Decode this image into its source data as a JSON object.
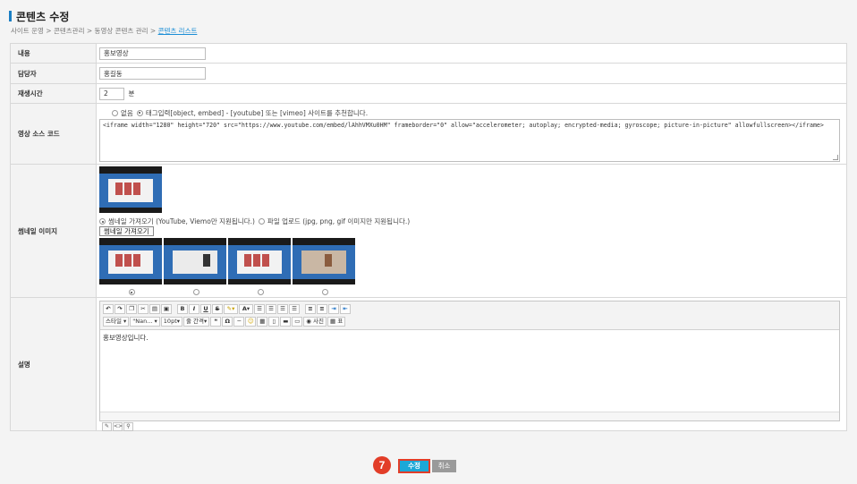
{
  "page": {
    "title": "콘텐츠 수정",
    "breadcrumb": [
      "사이트 운영",
      "콘텐츠관리",
      "동영상 콘텐츠 관리",
      "콘텐츠 리스트"
    ],
    "breadcrumb_sep": ">"
  },
  "form": {
    "content": {
      "label": "내용",
      "value": "홍보영상"
    },
    "manager": {
      "label": "담당자",
      "value": "홍길동"
    },
    "playtime": {
      "label": "재생시간",
      "value": "2",
      "unit": "분"
    },
    "video_source": {
      "label": "영상 소스 코드",
      "option_none": "없음",
      "option_tag": "태그입력[object, embed] - [youtube] 또는 [vimeo] 사이트를 추천합니다.",
      "code": "<iframe width=\"1280\" height=\"720\" src=\"https://www.youtube.com/embed/lAhhVMXu0HM\" frameborder=\"0\" allow=\"accelerometer; autoplay; encrypted-media; gyroscope; picture-in-picture\" allowfullscreen></iframe>"
    },
    "thumbnail": {
      "label": "썸네일 이미지",
      "option_fetch": "썸네일 가져오기 (YouTube, Viemo만 지원됩니다.)",
      "option_upload": "파일 업로드 (jpg, png, gif 이미지만 지원됩니다.)",
      "fetch_button": "썸네일 가져오기",
      "selected_index": 0
    },
    "description": {
      "label": "설명",
      "toolbar": {
        "style_select": "스타일",
        "font_select": "\"Nan...",
        "size_select": "10pt",
        "line_select": "줄 간격",
        "photo_button": "사진",
        "table_button": "표"
      },
      "content": "홍보영상입니다."
    }
  },
  "actions": {
    "step_number": "7",
    "save_label": "수정",
    "cancel_label": "취소"
  },
  "colors": {
    "accent": "#1ba8d8",
    "highlight": "#e23d28",
    "label_bg": "#f3f3f3"
  }
}
